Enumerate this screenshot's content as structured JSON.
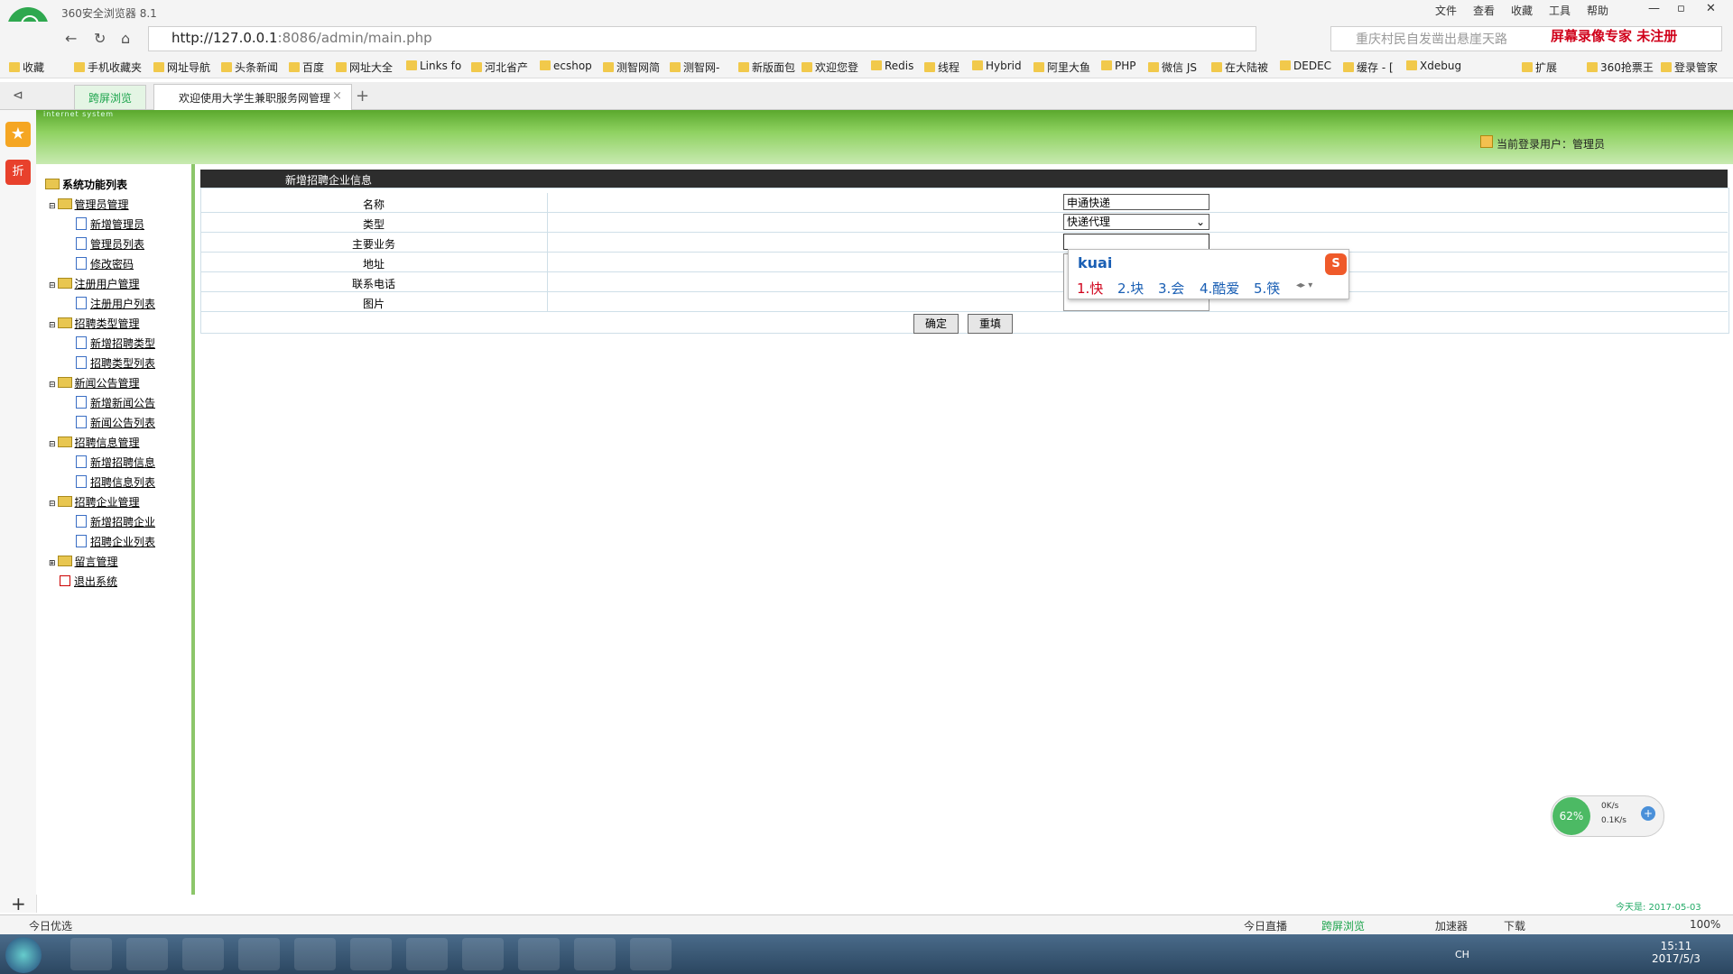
{
  "browser": {
    "app_title": "360安全浏览器 8.1",
    "menus": [
      "文件",
      "查看",
      "收藏",
      "工具",
      "帮助"
    ],
    "window_buttons": [
      "—",
      "▫",
      "✕"
    ],
    "url_host": "http://127.0.0.1",
    "url_rest": ":8086/admin/main.php",
    "search_placeholder": "重庆村民自发凿出悬崖天路",
    "recorder_text": "屏幕录像专家  未注册",
    "bookmarks": [
      "收藏",
      "手机收藏夹",
      "网址导航",
      "头条新闻",
      "百度",
      "网址大全",
      "Links fo",
      "河北省产",
      "ecshop",
      "测智网简",
      "测智网-",
      "新版面包",
      "欢迎您登",
      "Redis",
      "线程",
      "Hybrid",
      "阿里大鱼",
      "PHP",
      "微信 JS",
      "在大陆被",
      "DEDEC",
      "缓存 - [",
      "Xdebug",
      "扩展",
      "360抢票王",
      "登录管家"
    ],
    "tab_split_label": "跨屏浏览",
    "tab_main_label": "欢迎使用大学生兼职服务网管理"
  },
  "page": {
    "header_sub": "internet system",
    "current_user_label": "当前登录用户：管理员"
  },
  "sidebar": {
    "root": "系统功能列表",
    "groups": [
      {
        "label": "管理员管理",
        "items": [
          "新增管理员",
          "管理员列表",
          "修改密码"
        ]
      },
      {
        "label": "注册用户管理",
        "items": [
          "注册用户列表"
        ]
      },
      {
        "label": "招聘类型管理",
        "items": [
          "新增招聘类型",
          "招聘类型列表"
        ]
      },
      {
        "label": "新闻公告管理",
        "items": [
          "新增新闻公告",
          "新闻公告列表"
        ]
      },
      {
        "label": "招聘信息管理",
        "items": [
          "新增招聘信息",
          "招聘信息列表"
        ]
      },
      {
        "label": "招聘企业管理",
        "items": [
          "新增招聘企业",
          "招聘企业列表"
        ]
      }
    ],
    "message_mgmt": "留言管理",
    "logout": "退出系统"
  },
  "form": {
    "title": "新增招聘企业信息",
    "labels": {
      "name": "名称",
      "type": "类型",
      "business": "主要业务",
      "address": "地址",
      "phone": "联系电话",
      "image": "图片"
    },
    "values": {
      "name": "申通快递",
      "type": "快递代理",
      "business": ""
    },
    "submit_label": "确定",
    "reset_label": "重填"
  },
  "ime": {
    "pinyin": "kuai",
    "candidates": [
      "1.快",
      "2.块",
      "3.会",
      "4.酷爱",
      "5.筷"
    ]
  },
  "speed_widget": {
    "percent": "62%",
    "up": "0K/s",
    "down": "0.1K/s"
  },
  "statusbar": {
    "left": "今日优选",
    "items": [
      "今日直播",
      "跨屏浏览",
      "加速器",
      "下载"
    ],
    "zoom": "100%",
    "date_ticker": "今天是: 2017-05-03"
  },
  "taskbar": {
    "time": "15:11",
    "date": "2017/5/3",
    "lang": "CH"
  },
  "colors": {
    "accent_green": "#8ed160",
    "header_dark": "#2d2d2d",
    "recorder_red": "#d0021b"
  }
}
